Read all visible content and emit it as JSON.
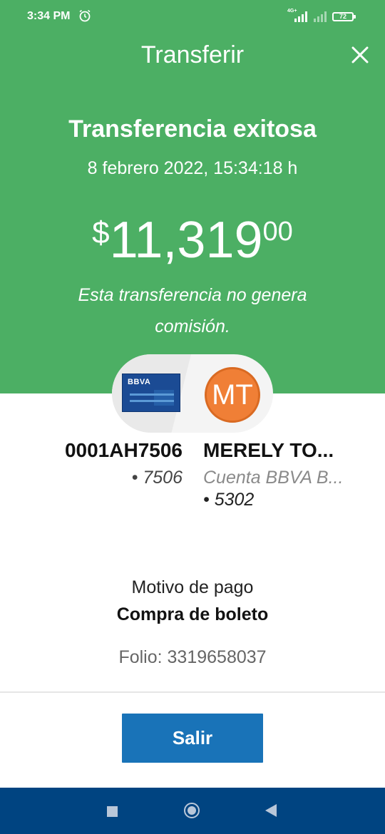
{
  "status_bar": {
    "time": "3:34 PM",
    "network": "4G+",
    "battery": "72"
  },
  "header": {
    "title": "Transferir"
  },
  "result": {
    "headline": "Transferencia exitosa",
    "date": "8 febrero 2022, 15:34:18 h",
    "amount": {
      "currency": "$",
      "main": "11,319",
      "cents": "00"
    },
    "fee_note": "Esta transferencia no genera comisión."
  },
  "origin": {
    "bank_logo": "BBVA",
    "account_name": "0001AH7506",
    "last_digits": "• 7506"
  },
  "destination": {
    "initials": "MT",
    "name": "MERELY TO...",
    "account_type": "Cuenta BBVA B...",
    "last_digits": "• 5302"
  },
  "details": {
    "motivo_label": "Motivo de pago",
    "motivo_value": "Compra de boleto",
    "folio": "Folio: 3319658037"
  },
  "actions": {
    "exit_label": "Salir"
  },
  "colors": {
    "success_green": "#4caf64",
    "primary_blue": "#1973b8",
    "navbar": "#004481",
    "avatar_orange": "#f07f36"
  }
}
